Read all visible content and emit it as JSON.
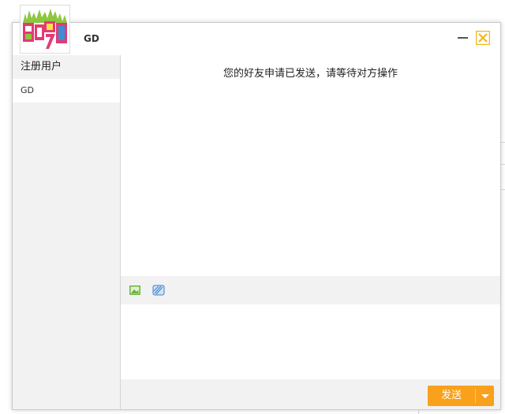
{
  "window": {
    "title": "GD"
  },
  "sidebar": {
    "header": "注册用户",
    "users": [
      "GD"
    ]
  },
  "chat": {
    "status_message": "您的好友申请已发送，请等待对方操作"
  },
  "toolbar": {
    "icons": [
      "image-icon",
      "emoji-icon"
    ]
  },
  "footer": {
    "send_label": "发送"
  },
  "colors": {
    "accent": "#f9a11b",
    "close_button": "#f5b51c",
    "panel_bg": "#f2f2f2"
  }
}
